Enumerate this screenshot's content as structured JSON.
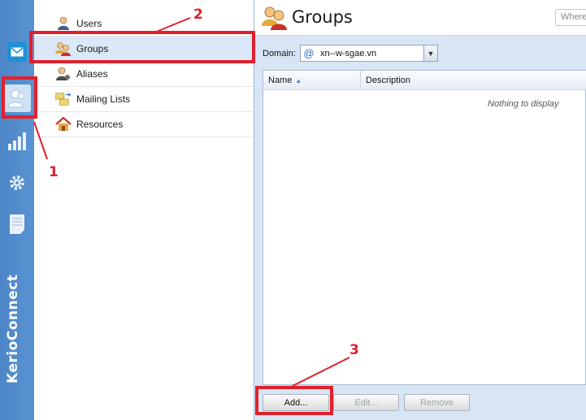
{
  "brand": {
    "name": "KerioConnect"
  },
  "rail": {
    "items": [
      {
        "icon": "mail-icon"
      },
      {
        "icon": "users-icon",
        "selected": true
      },
      {
        "icon": "statistics-icon"
      },
      {
        "icon": "settings-gear-icon"
      },
      {
        "icon": "logs-icon"
      }
    ]
  },
  "nav": {
    "items": [
      {
        "label": "Users",
        "icon": "user-icon"
      },
      {
        "label": "Groups",
        "icon": "group-icon",
        "selected": true
      },
      {
        "label": "Aliases",
        "icon": "alias-icon"
      },
      {
        "label": "Mailing Lists",
        "icon": "mailing-list-icon"
      },
      {
        "label": "Resources",
        "icon": "resource-house-icon"
      }
    ]
  },
  "main": {
    "title": "Groups",
    "search_placeholder": "Where",
    "domain_label": "Domain:",
    "domain_value": "xn--w-sgae.vn",
    "columns": [
      "Name",
      "Description"
    ],
    "empty_text": "Nothing to display",
    "buttons": {
      "add": "Add...",
      "edit": "Edit...",
      "remove": "Remove"
    }
  },
  "annotations": [
    "1",
    "2",
    "3"
  ],
  "colors": {
    "annotation": "#e2202b",
    "rail": "#4d86c6",
    "panel": "#d8e5f4"
  }
}
